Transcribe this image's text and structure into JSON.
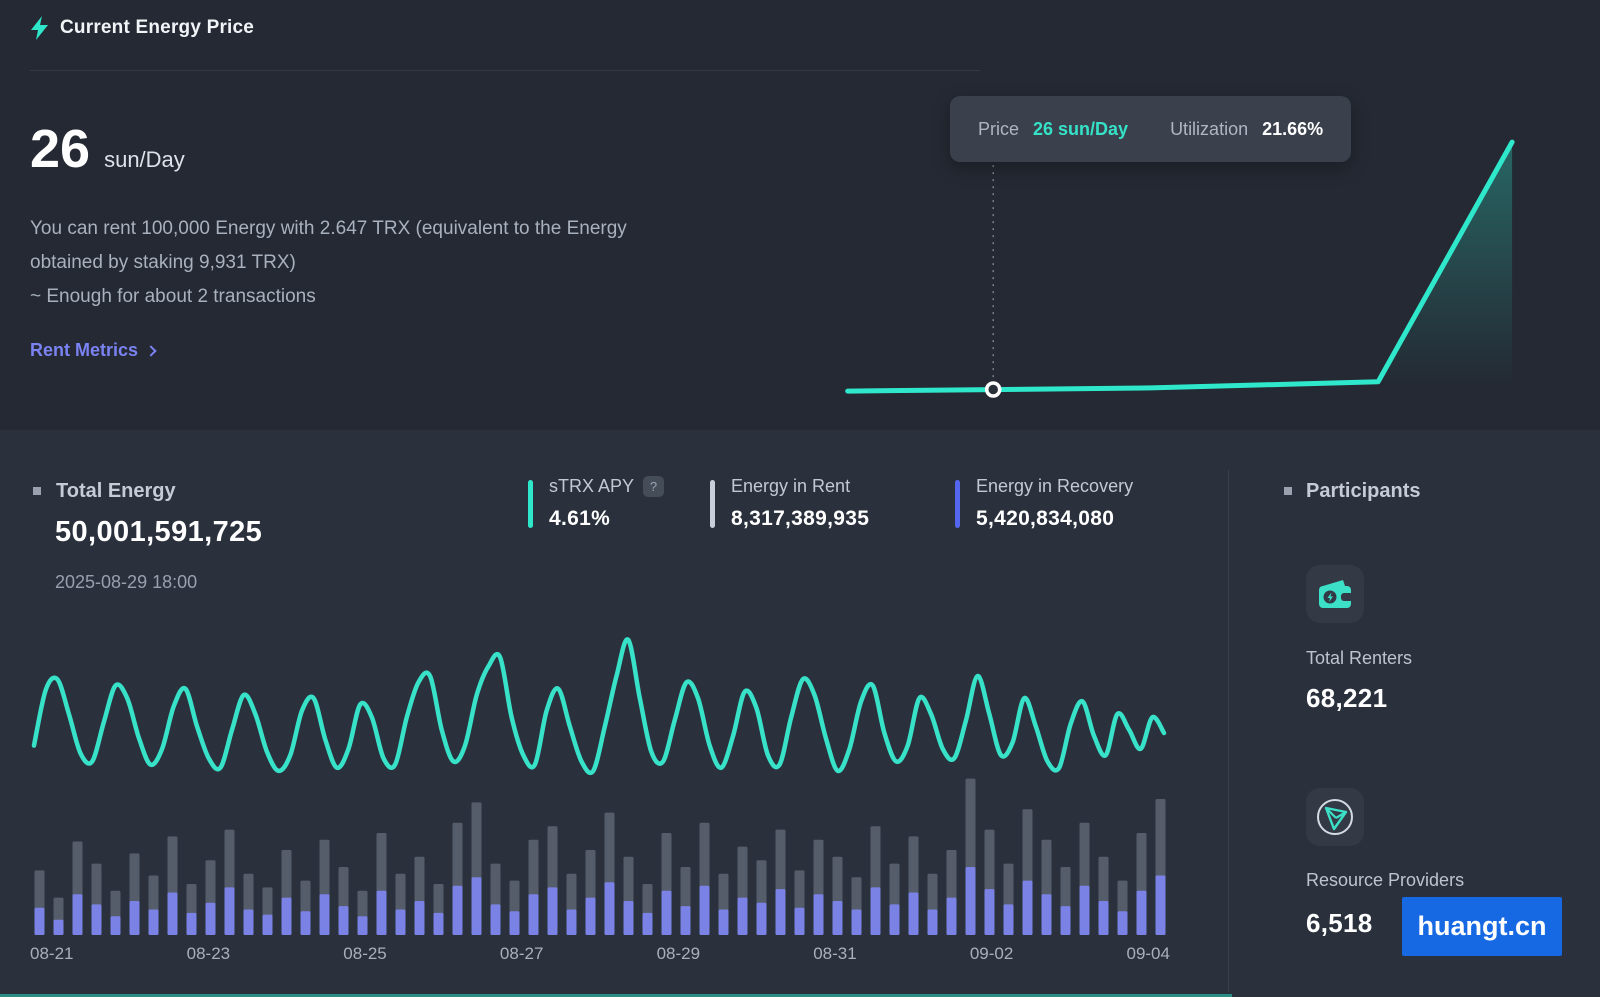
{
  "header": {
    "title": "Current Energy Price"
  },
  "price": {
    "value": "26",
    "unit": "sun/Day",
    "desc_line1": "You can rent 100,000 Energy with 2.647 TRX (equivalent to the Energy",
    "desc_line2": "obtained by staking 9,931 TRX)",
    "desc_line3": "~ Enough for about 2 transactions",
    "link_label": "Rent Metrics"
  },
  "tooltip": {
    "price_label": "Price",
    "price_value": "26 sun/Day",
    "utilization_label": "Utilization",
    "utilization_value": "21.66%"
  },
  "stats": {
    "total_energy_label": "Total Energy",
    "total_energy_value": "50,001,591,725",
    "timestamp": "2025-08-29 18:00",
    "items": [
      {
        "label": "sTRX APY",
        "help": "?",
        "value": "4.61%",
        "accent": "#2EE6C9"
      },
      {
        "label": "Energy in Rent",
        "value": "8,317,389,935",
        "accent": "#C9CFDA"
      },
      {
        "label": "Energy in Recovery",
        "value": "5,420,834,080",
        "accent": "#5566EE"
      }
    ]
  },
  "participants": {
    "title": "Participants",
    "renters_label": "Total Renters",
    "renters_value": "68,221",
    "providers_label": "Resource Providers",
    "providers_value": "6,518"
  },
  "watermark": "huangt.cn",
  "colors": {
    "teal": "#2EE6C9",
    "link_purple": "#7B82F2",
    "bar_gray": "#565D6A",
    "bar_purple": "#7B82E6",
    "tooltip_bg": "#3A414C",
    "bg_top": "#242933",
    "bg_bottom": "#2A313D",
    "watermark_blue": "#1668E3"
  },
  "chart_data": [
    {
      "id": "price-utilization-curve",
      "type": "line",
      "description": "Energy price curve: flat at 26 sun/Day, spiking sharply at high utilization",
      "hover_point": {
        "price": "26 sun/Day",
        "utilization": "21.66%"
      },
      "color": "#2FE8CC",
      "points_norm": [
        [
          0.004,
          0.955
        ],
        [
          0.45,
          0.945
        ],
        [
          0.784,
          0.925
        ],
        [
          0.981,
          0.152
        ]
      ],
      "marker_norm": [
        0.218,
        0.95
      ],
      "dash_top_norm": 0.226
    },
    {
      "id": "total-energy-history",
      "type": "composite",
      "x_tick_labels": [
        "08-21",
        "08-23",
        "08-25",
        "08-27",
        "08-29",
        "08-31",
        "09-02",
        "09-04"
      ],
      "value_scale": "relative 0-100 (no y-axis shown in UI)",
      "line": {
        "name": "total-energy-trend",
        "color": "#38E2C9",
        "values": [
          30,
          65,
          72,
          50,
          25,
          20,
          45,
          68,
          60,
          35,
          18,
          28,
          55,
          66,
          42,
          22,
          16,
          40,
          62,
          50,
          26,
          14,
          24,
          52,
          60,
          34,
          16,
          28,
          56,
          48,
          22,
          18,
          48,
          70,
          74,
          40,
          20,
          30,
          62,
          80,
          86,
          48,
          24,
          18,
          52,
          66,
          42,
          20,
          14,
          42,
          74,
          97,
          60,
          26,
          20,
          46,
          70,
          60,
          30,
          16,
          36,
          64,
          54,
          24,
          18,
          48,
          72,
          62,
          34,
          14,
          28,
          58,
          68,
          38,
          20,
          30,
          60,
          50,
          28,
          22,
          46,
          74,
          50,
          24,
          32,
          60,
          42,
          20,
          16,
          44,
          58,
          36,
          24,
          50,
          40,
          28,
          48,
          38
        ]
      },
      "bars": {
        "upper": {
          "name": "energy-volume-total",
          "color": "#565D6A",
          "values": [
            38,
            22,
            55,
            42,
            26,
            48,
            35,
            58,
            30,
            44,
            62,
            36,
            28,
            50,
            32,
            56,
            40,
            26,
            60,
            36,
            46,
            30,
            66,
            78,
            42,
            32,
            56,
            64,
            36,
            50,
            72,
            46,
            30,
            60,
            40,
            66,
            36,
            52,
            44,
            62,
            38,
            56,
            46,
            34,
            64,
            42,
            58,
            36,
            50,
            92,
            62,
            42,
            74,
            56,
            40,
            66,
            46,
            32,
            60,
            80
          ]
        },
        "lower": {
          "name": "energy-volume-rented",
          "color": "#7B82E6",
          "values": [
            16,
            9,
            24,
            18,
            11,
            20,
            15,
            25,
            13,
            19,
            28,
            15,
            12,
            22,
            14,
            24,
            17,
            11,
            26,
            15,
            20,
            13,
            29,
            34,
            18,
            14,
            24,
            28,
            15,
            22,
            31,
            20,
            13,
            26,
            17,
            29,
            15,
            22,
            19,
            27,
            16,
            24,
            20,
            15,
            28,
            18,
            25,
            15,
            22,
            40,
            27,
            18,
            32,
            24,
            17,
            29,
            20,
            14,
            26,
            35
          ]
        }
      }
    }
  ]
}
